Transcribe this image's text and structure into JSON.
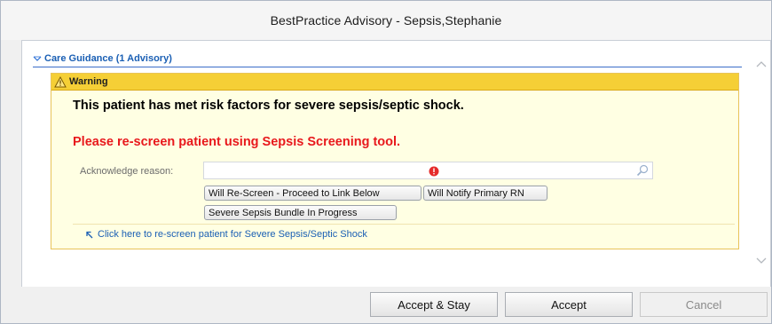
{
  "window": {
    "title": "BestPractice Advisory  - Sepsis,Stephanie"
  },
  "section": {
    "label": "Care Guidance (1 Advisory)",
    "icon": "chevron-down-icon"
  },
  "advisory": {
    "header_label": "Warning",
    "header_icon": "warning-triangle-icon",
    "message_primary": "This patient has met risk factors for severe sepsis/septic shock.",
    "message_secondary": "Please re-screen patient using Sepsis Screening tool.",
    "acknowledge": {
      "label": "Acknowledge reason:",
      "value": "",
      "required_icon": "error-icon",
      "search_icon": "search-icon"
    },
    "reasons": [
      {
        "label": "Will Re-Screen - Proceed to Link Below"
      },
      {
        "label": "Will Notify Primary RN"
      },
      {
        "label": "Severe Sepsis Bundle In Progress"
      }
    ],
    "link_text": "Click here to re-screen patient for Severe Sepsis/Septic Shock"
  },
  "footer": {
    "accept_stay": "Accept & Stay",
    "accept": "Accept",
    "cancel": "Cancel"
  },
  "colors": {
    "warning_header": "#f5cf36",
    "advisory_bg": "#ffffe3",
    "alert_text": "#e8181c",
    "link": "#1a5fb4"
  }
}
